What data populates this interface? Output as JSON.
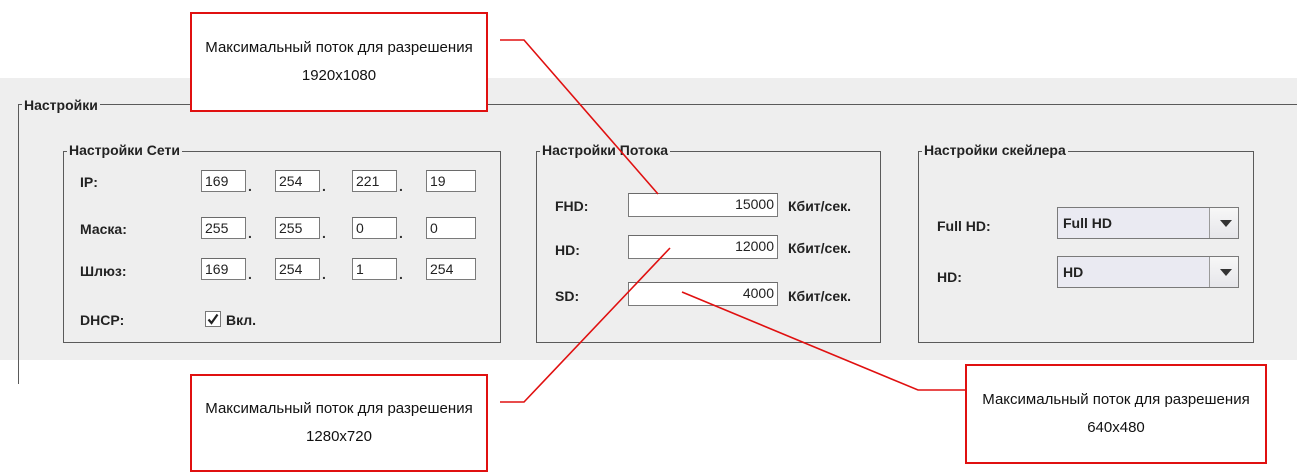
{
  "settings": {
    "title": "Настройки"
  },
  "network": {
    "title": "Настройки Сети",
    "ip_label": "IP:",
    "ip": [
      "169",
      "254",
      "221",
      "19"
    ],
    "mask_label": "Маска:",
    "mask": [
      "255",
      "255",
      "0",
      "0"
    ],
    "gateway_label": "Шлюз:",
    "gateway": [
      "169",
      "254",
      "1",
      "254"
    ],
    "separator": ".",
    "dhcp_label": "DHCP:",
    "dhcp_checked": true,
    "dhcp_text": "Вкл."
  },
  "stream": {
    "title": "Настройки Потока",
    "fhd_label": "FHD:",
    "fhd_value": "15000",
    "hd_label": "HD:",
    "hd_value": "12000",
    "sd_label": "SD:",
    "sd_value": "4000",
    "unit": "Кбит/сек."
  },
  "scaler": {
    "title": "Настройки скейлера",
    "fullhd_label": "Full HD:",
    "fullhd_value": "Full HD",
    "hd_label": "HD:",
    "hd_value": "HD"
  },
  "callouts": {
    "fhd": "Максимальный поток для разрешения 1920x1080",
    "hd": "Максимальный поток для разрешения 1280x720",
    "sd": "Максимальный поток для разрешения 640x480"
  },
  "colors": {
    "annotation": "#e01010",
    "panel_bg": "#eeeeee"
  }
}
